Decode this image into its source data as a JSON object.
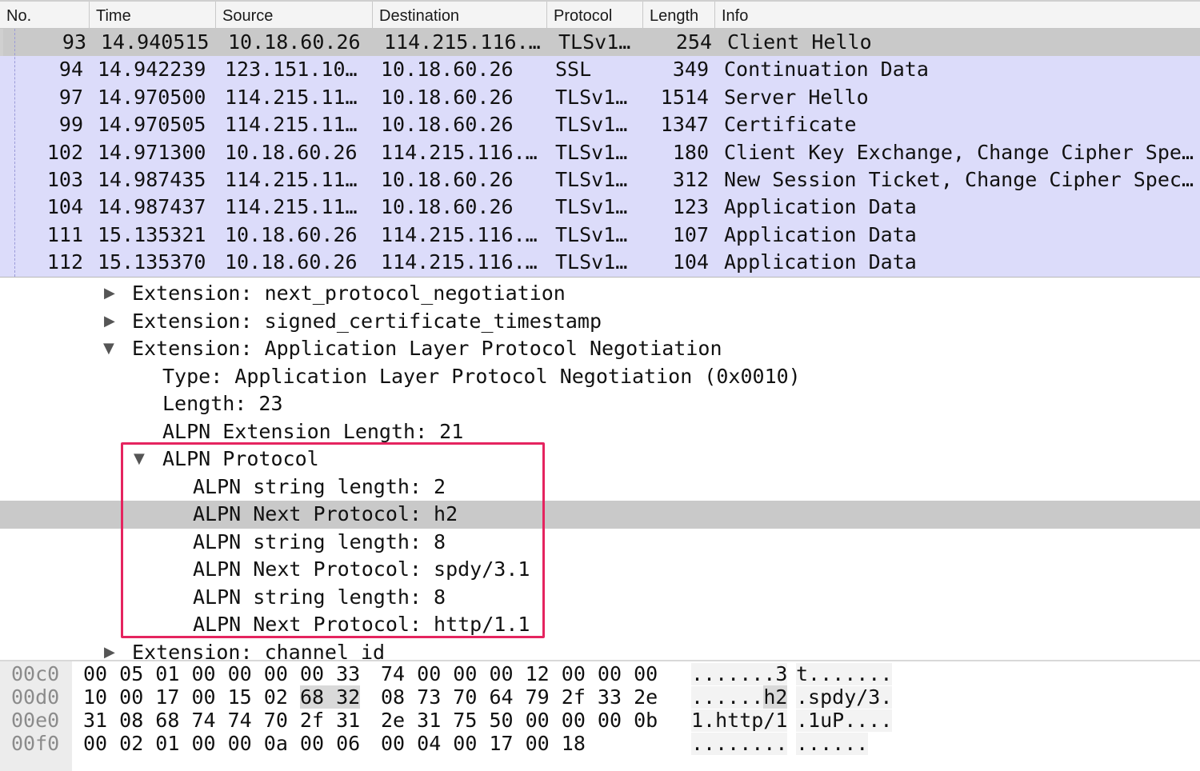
{
  "packet_list": {
    "columns": [
      "No.",
      "Time",
      "Source",
      "Destination",
      "Protocol",
      "Length",
      "Info"
    ],
    "rows": [
      {
        "no": "93",
        "time": "14.940515",
        "source": "10.18.60.26",
        "destination": "114.215.116.…",
        "protocol": "TLSv1…",
        "length": "254",
        "info": "Client Hello"
      },
      {
        "no": "94",
        "time": "14.942239",
        "source": "123.151.10…",
        "destination": "10.18.60.26",
        "protocol": "SSL",
        "length": "349",
        "info": "Continuation Data"
      },
      {
        "no": "97",
        "time": "14.970500",
        "source": "114.215.11…",
        "destination": "10.18.60.26",
        "protocol": "TLSv1…",
        "length": "1514",
        "info": "Server Hello"
      },
      {
        "no": "99",
        "time": "14.970505",
        "source": "114.215.11…",
        "destination": "10.18.60.26",
        "protocol": "TLSv1…",
        "length": "1347",
        "info": "Certificate"
      },
      {
        "no": "102",
        "time": "14.971300",
        "source": "10.18.60.26",
        "destination": "114.215.116.…",
        "protocol": "TLSv1…",
        "length": "180",
        "info": "Client Key Exchange, Change Cipher Spe…"
      },
      {
        "no": "103",
        "time": "14.987435",
        "source": "114.215.11…",
        "destination": "10.18.60.26",
        "protocol": "TLSv1…",
        "length": "312",
        "info": "New Session Ticket, Change Cipher Spec…"
      },
      {
        "no": "104",
        "time": "14.987437",
        "source": "114.215.11…",
        "destination": "10.18.60.26",
        "protocol": "TLSv1…",
        "length": "123",
        "info": "Application Data"
      },
      {
        "no": "111",
        "time": "15.135321",
        "source": "10.18.60.26",
        "destination": "114.215.116.…",
        "protocol": "TLSv1…",
        "length": "107",
        "info": "Application Data"
      },
      {
        "no": "112",
        "time": "15.135370",
        "source": "10.18.60.26",
        "destination": "114.215.116.…",
        "protocol": "TLSv1…",
        "length": "104",
        "info": "Application Data"
      }
    ]
  },
  "detail_tree": {
    "rows": [
      {
        "text": "Extension: next_protocol_negotiation",
        "toggle": "▶"
      },
      {
        "text": "Extension: signed_certificate_timestamp",
        "toggle": "▶"
      },
      {
        "text": "Extension: Application Layer Protocol Negotiation",
        "toggle": "▼"
      },
      {
        "text": "Type: Application Layer Protocol Negotiation (0x0010)",
        "toggle": ""
      },
      {
        "text": "Length: 23",
        "toggle": ""
      },
      {
        "text": "ALPN Extension Length: 21",
        "toggle": ""
      },
      {
        "text": "ALPN Protocol",
        "toggle": "▼"
      },
      {
        "text": "ALPN string length: 2",
        "toggle": ""
      },
      {
        "text": "ALPN Next Protocol: h2",
        "toggle": ""
      },
      {
        "text": "ALPN string length: 8",
        "toggle": ""
      },
      {
        "text": "ALPN Next Protocol: spdy/3.1",
        "toggle": ""
      },
      {
        "text": "ALPN string length: 8",
        "toggle": ""
      },
      {
        "text": "ALPN Next Protocol: http/1.1",
        "toggle": ""
      },
      {
        "text": "Extension: channel_id",
        "toggle": "▶"
      }
    ]
  },
  "hex_dump": {
    "rows": [
      {
        "offset": "00c0",
        "hex1": "00 05 01 00 00 00 00 33",
        "hex2": "74 00 00 00 12 00 00 00",
        "ascii1": ".......3",
        "ascii2": "t......."
      },
      {
        "offset": "00d0",
        "hex1_pre": "10 00 17 00 15 02 ",
        "hex1_mark": "68 32",
        "hex2": "08 73 70 64 79 2f 33 2e",
        "ascii1_pre": "......",
        "ascii1_mark": "h2",
        "ascii2": ".spdy/3."
      },
      {
        "offset": "00e0",
        "hex1": "31 08 68 74 74 70 2f 31",
        "hex2": "2e 31 75 50 00 00 00 0b",
        "ascii1": "1.http/1",
        "ascii2": ".1uP...."
      },
      {
        "offset": "00f0",
        "hex1": "00 02 01 00 00 0a 00 06",
        "hex2": "00 04 00 17 00 18",
        "ascii1": "........",
        "ascii2": "......"
      }
    ]
  },
  "colors": {
    "row_background": "#dcdcfa",
    "selected_row": "#c9c9c9",
    "highlight_box": "#e5245f"
  }
}
